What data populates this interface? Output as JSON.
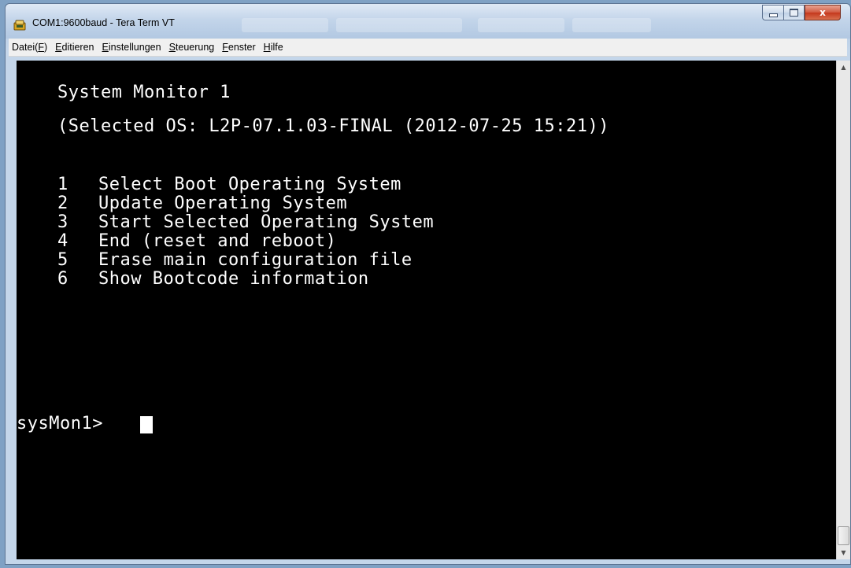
{
  "window": {
    "title": "COM1:9600baud - Tera Term VT",
    "close_glyph": "x"
  },
  "menu": {
    "items": [
      {
        "pre": "Datei(",
        "ul": "F",
        "post": ")"
      },
      {
        "pre": "",
        "ul": "E",
        "post": "ditieren"
      },
      {
        "pre": "",
        "ul": "E",
        "post": "instellungen"
      },
      {
        "pre": "",
        "ul": "S",
        "post": "teuerung"
      },
      {
        "pre": "",
        "ul": "F",
        "post": "enster"
      },
      {
        "pre": "",
        "ul": "H",
        "post": "ilfe"
      }
    ]
  },
  "terminal": {
    "title": "System Monitor 1",
    "selected_os": "(Selected OS: L2P-07.1.03-FINAL (2012-07-25 15:21))",
    "options": [
      {
        "num": "1",
        "label": "Select Boot Operating System"
      },
      {
        "num": "2",
        "label": "Update Operating System"
      },
      {
        "num": "3",
        "label": "Start Selected Operating System"
      },
      {
        "num": "4",
        "label": "End (reset and reboot)"
      },
      {
        "num": "5",
        "label": "Erase main configuration file"
      },
      {
        "num": "6",
        "label": "Show Bootcode information"
      }
    ],
    "prompt": "sysMon1>"
  },
  "colors": {
    "terminal_bg": "#000000",
    "terminal_fg": "#ffffff",
    "close_button": "#c4371c"
  },
  "icons": {
    "app": "tera-term-icon",
    "scroll_up": "arrow-up-icon",
    "scroll_down": "arrow-down-icon"
  }
}
